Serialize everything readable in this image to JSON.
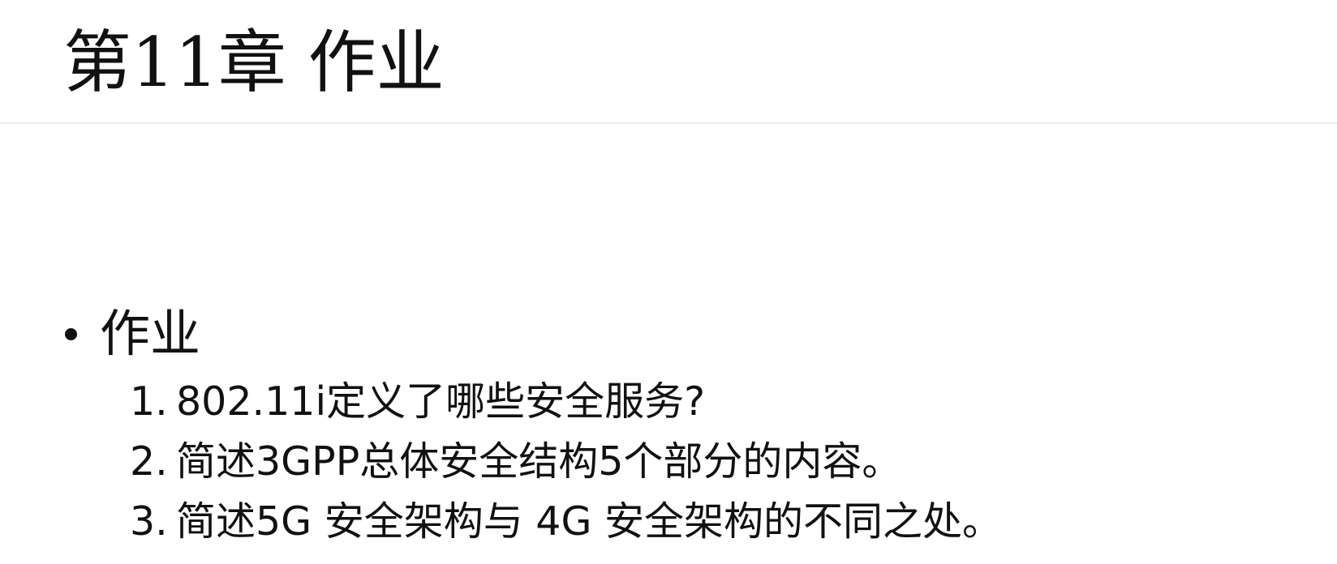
{
  "slide": {
    "title": "第11章 作业"
  },
  "bullet": {
    "text": "作业"
  },
  "items": [
    {
      "number": "1.",
      "text": "802.11i定义了哪些安全服务?"
    },
    {
      "number": "2.",
      "text": "简述3GPP总体安全结构5个部分的内容。"
    },
    {
      "number": "3.",
      "text": "简述5G 安全架构与 4G 安全架构的不同之处。"
    }
  ]
}
